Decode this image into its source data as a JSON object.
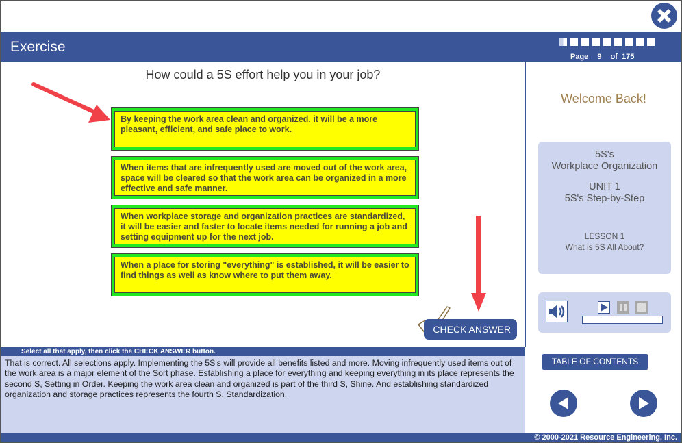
{
  "window": {
    "close_icon": "close-x-icon"
  },
  "header": {
    "title": "Exercise",
    "progress_segments": 9,
    "progress_fraction": 0.05,
    "page_label": "Page",
    "page_current": "9",
    "page_of_label": "of",
    "page_total": "175"
  },
  "exercise": {
    "question": "How could a 5S effort help you in your job?",
    "options": [
      {
        "text": "By keeping the work area clean and organized, it will be a more pleasant, efficient, and safe place to work.",
        "selected": true
      },
      {
        "text": "When items that are infrequently used are moved out of the work area, space will be cleared so that the work area can be organized in a more effective and safe manner.",
        "selected": true
      },
      {
        "text": "When workplace storage and organization practices are standardized, it will be easier and faster to locate items needed for running a job and setting equipment up for the next job.",
        "selected": true
      },
      {
        "text": "When a place for storing \"everything\" is established, it will be easier to find things as well as know where to put them away.",
        "selected": true
      }
    ],
    "check_answer_label": "CHECK ANSWER",
    "instruction": "Select all that apply, then click the CHECK ANSWER button.",
    "feedback": "That is correct. All selections apply.  Implementing the 5S's will provide all benefits listed and more. Moving infrequently used items out of the work area is a major element of the Sort phase. Establishing a place for everything and keeping everything in its place represents the second S, Setting in Order. Keeping the work area clean and organized is part of the third S, Shine. And establishing standardized organization and storage practices represents the fourth S, Standardization."
  },
  "sidebar": {
    "welcome": "Welcome Back!",
    "course_line1": "5S's",
    "course_line2": "Workplace Organization",
    "unit_line1": "UNIT 1",
    "unit_line2": "5S's Step-by-Step",
    "lesson_line1": "LESSON 1",
    "lesson_line2": "What is 5S All About?",
    "audio_progress": 0,
    "toc_label": "TABLE OF CONTENTS"
  },
  "footer": {
    "copyright": "© 2000-2021 Resource Engineering, Inc."
  },
  "colors": {
    "brand_blue": "#3a5698",
    "panel_lavender": "#ced5ee",
    "option_yellow": "#ffff00",
    "option_green_border": "#22e822",
    "annotation_red": "#f04048",
    "welcome_gold": "#a08050"
  }
}
